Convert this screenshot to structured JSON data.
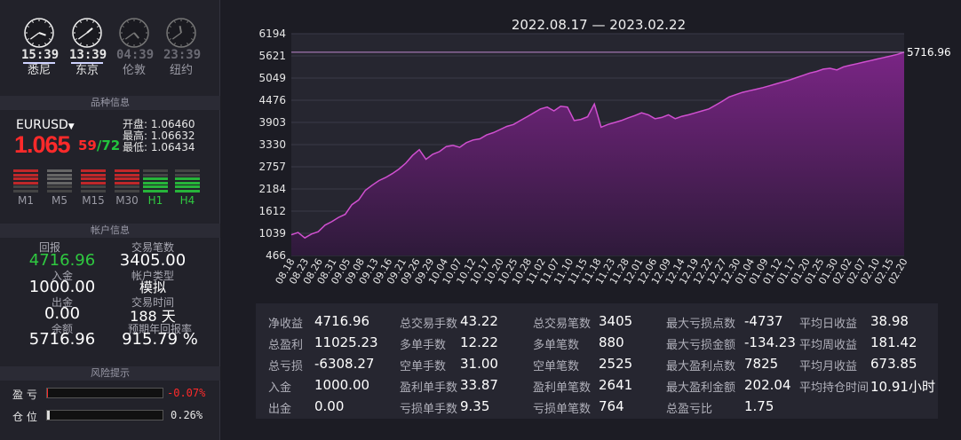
{
  "clocks": [
    {
      "time": "15:39",
      "city": "悉尼",
      "active": true
    },
    {
      "time": "13:39",
      "city": "东京",
      "active": true
    },
    {
      "time": "04:39",
      "city": "伦敦",
      "active": false
    },
    {
      "time": "23:39",
      "city": "纽约",
      "active": false
    }
  ],
  "instrument": {
    "section_title": "品种信息",
    "symbol": "EURUSD",
    "big_price": "1.065",
    "small_price_a": "59",
    "small_sep": "/",
    "small_price_b": "72",
    "open_label": "开盘:",
    "open": "1.06460",
    "high_label": "最高:",
    "high": "1.06632",
    "low_label": "最低:",
    "low": "1.06434",
    "timeframes": [
      {
        "label": "M1",
        "color": "red"
      },
      {
        "label": "M5",
        "color": "gray"
      },
      {
        "label": "M15",
        "color": "red"
      },
      {
        "label": "M30",
        "color": "red"
      },
      {
        "label": "H1",
        "color": "green"
      },
      {
        "label": "H4",
        "color": "green"
      }
    ]
  },
  "account": {
    "section_title": "帐户信息",
    "return_label": "回报",
    "return": "4716.96",
    "trades_label": "交易笔数",
    "trades": "3405.00",
    "deposit_label": "入金",
    "deposit": "1000.00",
    "type_label": "帐户类型",
    "type": "模拟",
    "withdraw_label": "出金",
    "withdraw": "0.00",
    "time_label": "交易时间",
    "time": "188 天",
    "balance_label": "余额",
    "balance": "5716.96",
    "annual_label": "预期年回报率",
    "annual": "915.79 %"
  },
  "risk": {
    "section_title": "风险提示",
    "pl_label": "盈 亏",
    "pl_value": "-0.07%",
    "pos_label": "仓 位",
    "pos_value": "0.26%",
    "pl_fraction": 0.0007,
    "pos_fraction": 0.0026
  },
  "colors": {
    "fill": "#6a1f72",
    "line": "#c040c0",
    "accent_red": "#ff2a2a",
    "accent_green": "#22c33d"
  },
  "chart_data": {
    "type": "area",
    "title": "2022.08.17 — 2023.02.22",
    "y_ticks": [
      466,
      1039,
      1612,
      2184,
      2757,
      3330,
      3903,
      4476,
      5049,
      5621,
      6194
    ],
    "ylim": [
      466,
      6194
    ],
    "last_value_label": "5716.96",
    "x_ticks": [
      "08.18",
      "08.23",
      "08.26",
      "08.31",
      "09.05",
      "09.08",
      "09.13",
      "09.16",
      "09.21",
      "09.26",
      "09.29",
      "10.04",
      "10.07",
      "10.12",
      "10.17",
      "10.20",
      "10.25",
      "10.28",
      "11.02",
      "11.07",
      "11.10",
      "11.15",
      "11.18",
      "11.23",
      "11.28",
      "12.01",
      "12.06",
      "12.09",
      "12.14",
      "12.19",
      "12.22",
      "12.27",
      "12.30",
      "01.04",
      "01.09",
      "01.12",
      "01.17",
      "01.20",
      "01.25",
      "01.30",
      "02.02",
      "02.07",
      "02.10",
      "02.15",
      "02.20"
    ],
    "values": [
      1000,
      1060,
      920,
      1020,
      1080,
      1250,
      1340,
      1450,
      1530,
      1780,
      1900,
      2150,
      2280,
      2400,
      2480,
      2580,
      2700,
      2850,
      3050,
      3200,
      2950,
      3080,
      3150,
      3280,
      3310,
      3260,
      3380,
      3450,
      3480,
      3580,
      3640,
      3720,
      3800,
      3850,
      3950,
      4050,
      4150,
      4250,
      4300,
      4200,
      4320,
      4300,
      3950,
      3980,
      4050,
      4380,
      3780,
      3850,
      3900,
      3950,
      4020,
      4080,
      4150,
      4100,
      4000,
      4030,
      4100,
      4000,
      4060,
      4100,
      4150,
      4200,
      4250,
      4350,
      4450,
      4560,
      4620,
      4680,
      4720,
      4760,
      4800,
      4850,
      4900,
      4950,
      5000,
      5060,
      5120,
      5180,
      5220,
      5280,
      5300,
      5260,
      5340,
      5380,
      5420,
      5460,
      5500,
      5540,
      5580,
      5620,
      5660,
      5716.96
    ]
  },
  "stats": [
    [
      [
        "净收益",
        "4716.96"
      ],
      [
        "总交易手数",
        "43.22"
      ],
      [
        "总交易笔数",
        "3405"
      ],
      [
        "最大亏损点数",
        "-4737"
      ],
      [
        "平均日收益",
        "38.98"
      ]
    ],
    [
      [
        "总盈利",
        "11025.23"
      ],
      [
        "多单手数",
        "12.22"
      ],
      [
        "多单笔数",
        "880"
      ],
      [
        "最大亏损金额",
        "-134.23"
      ],
      [
        "平均周收益",
        "181.42"
      ]
    ],
    [
      [
        "总亏损",
        "-6308.27"
      ],
      [
        "空单手数",
        "31.00"
      ],
      [
        "空单笔数",
        "2525"
      ],
      [
        "最大盈利点数",
        "7825"
      ],
      [
        "平均月收益",
        "673.85"
      ]
    ],
    [
      [
        "入金",
        "1000.00"
      ],
      [
        "盈利单手数",
        "33.87"
      ],
      [
        "盈利单笔数",
        "2641"
      ],
      [
        "最大盈利金额",
        "202.04"
      ],
      [
        "平均持仓时间",
        "10.91小时"
      ]
    ],
    [
      [
        "出金",
        "0.00"
      ],
      [
        "亏损单手数",
        "9.35"
      ],
      [
        "亏损单笔数",
        "764"
      ],
      [
        "总盈亏比",
        "1.75"
      ],
      [
        "",
        ""
      ]
    ]
  ]
}
